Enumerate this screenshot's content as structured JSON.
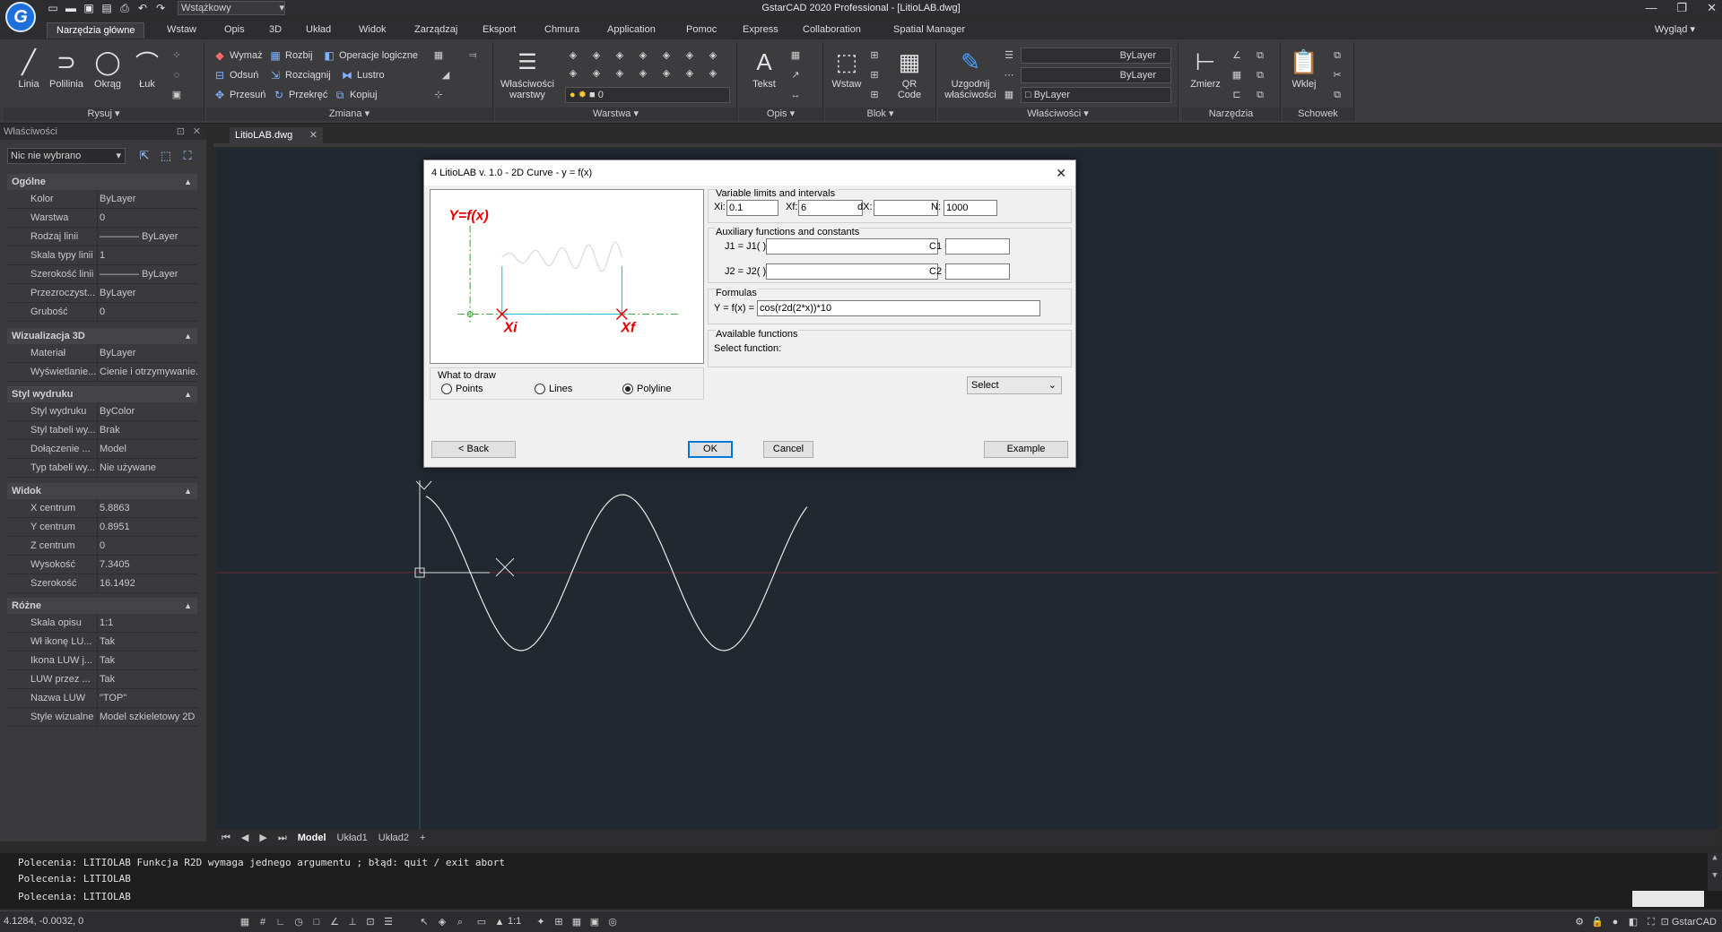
{
  "app": {
    "title": "GstarCAD 2020 Professional - [LitioLAB.dwg]",
    "logo_letter": "G",
    "workspace": "Wstążkowy",
    "view_menu": "Wygląd"
  },
  "menu_tabs": [
    "Narzędzia główne",
    "Wstaw",
    "Opis",
    "3D",
    "Układ",
    "Widok",
    "Zarządzaj",
    "Eksport",
    "Chmura",
    "Application",
    "Pomoc",
    "Express",
    "Collaboration",
    "Spatial Manager"
  ],
  "ribbon": {
    "draw": {
      "title": "Rysuj",
      "line": "Linia",
      "polyline": "Polilinia",
      "circle": "Okrąg",
      "arc": "Łuk"
    },
    "modify": {
      "title": "Zmiana",
      "erase": "Wymaż",
      "explode": "Rozbij",
      "logic_ops": "Operacje logiczne",
      "offset": "Odsuń",
      "stretch": "Rozciągnij",
      "mirror": "Lustro",
      "move": "Przesuń",
      "rotate": "Przekręć",
      "copy": "Kopiuj"
    },
    "layer": {
      "title": "Warstwa",
      "props_line1": "Właściwości",
      "props_line2": "warstwy",
      "current_layer": "0"
    },
    "annotation": {
      "title": "Opis",
      "text": "Tekst"
    },
    "block": {
      "title": "Blok",
      "insert": "Wstaw",
      "qr_line1": "QR",
      "qr_line2": "Code"
    },
    "properties": {
      "title": "Właściwości",
      "match_line1": "Uzgodnij",
      "match_line2": "właściwości",
      "color": "ByLayer",
      "linetype": "ByLayer",
      "lineweight": "ByLayer"
    },
    "tools": {
      "title": "Narzędzia",
      "measure": "Zmierz"
    },
    "clipboard": {
      "title": "Schowek",
      "paste": "Wklej"
    }
  },
  "props_palette": {
    "header": "Właściwości",
    "selection": "Nic nie wybrano",
    "sections": [
      {
        "title": "Ogólne",
        "rows": [
          [
            "Kolor",
            "ByLayer"
          ],
          [
            "Warstwa",
            "0"
          ],
          [
            "Rodzaj linii",
            "———— ByLayer"
          ],
          [
            "Skala typy linii",
            "1"
          ],
          [
            "Szerokość linii",
            "———— ByLayer"
          ],
          [
            "Przezroczyst...",
            "ByLayer"
          ],
          [
            "Grubość",
            "0"
          ]
        ]
      },
      {
        "title": "Wizualizacja 3D",
        "rows": [
          [
            "Materiał",
            "ByLayer"
          ],
          [
            "Wyświetlanie...",
            "Cienie i otrzymywanie..."
          ]
        ]
      },
      {
        "title": "Styl wydruku",
        "rows": [
          [
            "Styl wydruku",
            "ByColor"
          ],
          [
            "Styl tabeli wy...",
            "Brak"
          ],
          [
            "Dołączenie ...",
            "Model"
          ],
          [
            "Typ tabeli wy...",
            "Nie używane"
          ]
        ]
      },
      {
        "title": "Widok",
        "rows": [
          [
            "X centrum",
            "5.8863"
          ],
          [
            "Y centrum",
            "0.8951"
          ],
          [
            "Z centrum",
            "0"
          ],
          [
            "Wysokość",
            "7.3405"
          ],
          [
            "Szerokość",
            "16.1492"
          ]
        ]
      },
      {
        "title": "Różne",
        "rows": [
          [
            "Skala opisu",
            "1:1"
          ],
          [
            "Wł ikonę LU...",
            "Tak"
          ],
          [
            "Ikona LUW j...",
            "Tak"
          ],
          [
            "LUW przez ...",
            "Tak"
          ],
          [
            "Nazwa LUW",
            "\"TOP\""
          ],
          [
            "Style wizualne",
            "Model szkieletowy 2D"
          ]
        ]
      }
    ]
  },
  "document_tab": "LitioLAB.dwg",
  "layout_tabs": [
    "Model",
    "Układ1",
    "Układ2",
    "+"
  ],
  "dialog": {
    "title": "4 LitioLAB v. 1.0 - 2D Curve - y = f(x)",
    "preview": {
      "formula_label": "Y=f(x)",
      "xi_label": "Xi",
      "xf_label": "Xf"
    },
    "limits": {
      "title": "Variable limits and intervals",
      "xi_label": "Xi:",
      "xi": "0.1",
      "xf_label": "Xf:",
      "xf": "6",
      "dx_label": "dX:",
      "dx": "",
      "n_label": "N:",
      "n": "1000"
    },
    "aux": {
      "title": "Auxiliary functions and constants",
      "j1_label": "J1 = J1( ) =",
      "j1": "",
      "c1_label": "C1 =",
      "c1": "",
      "j2_label": "J2 = J2( ) =",
      "j2": "",
      "c2_label": "C2 =",
      "c2": ""
    },
    "formulas": {
      "title": "Formulas",
      "y_label": "Y = f(x) =",
      "y": "cos(r2d(2*x))*10"
    },
    "available": {
      "title": "Available functions",
      "select_label": "Select function:",
      "select_value": "Select"
    },
    "draw": {
      "title": "What to draw",
      "options": [
        "Points",
        "Lines",
        "Polyline"
      ],
      "selected": "Polyline"
    },
    "buttons": {
      "back": "< Back",
      "ok": "OK",
      "cancel": "Cancel",
      "example": "Example"
    }
  },
  "command_line": [
    "Polecenia: LITIOLAB Funkcja R2D wymaga jednego argumentu ; błąd: quit / exit abort",
    "Polecenia:  LITIOLAB",
    "Polecenia:  LITIOLAB"
  ],
  "status": {
    "coords": "4.1284, -0.0032, 0",
    "scale": "1:1",
    "brand": "GstarCAD"
  }
}
